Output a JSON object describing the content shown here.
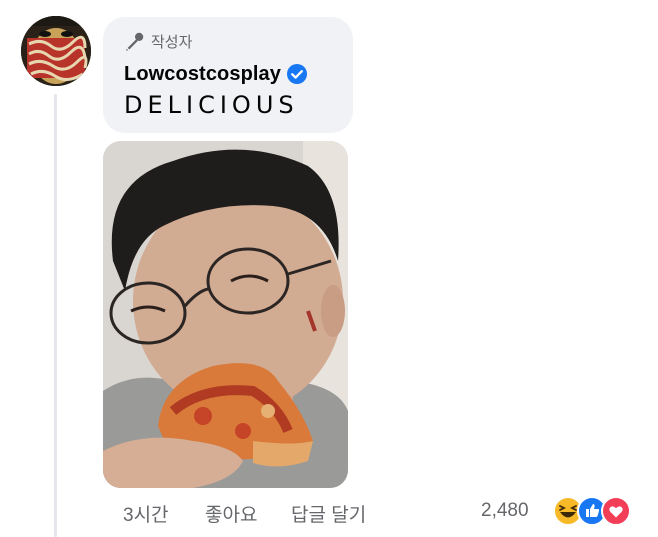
{
  "comment": {
    "author_badge": "작성자",
    "author_name": "Lowcostcosplay",
    "text": "DELICIOUS"
  },
  "actions": {
    "time": "3시간",
    "like": "좋아요",
    "reply": "답글 달기"
  },
  "reactions": {
    "count": "2,480",
    "icons": [
      "haha-icon",
      "like-icon",
      "love-icon"
    ]
  },
  "colors": {
    "bubble": "#f0f2f5",
    "secondary_text": "#65676b",
    "verified": "#1877f2",
    "love": "#f33e58",
    "haha": "#f7b928"
  }
}
